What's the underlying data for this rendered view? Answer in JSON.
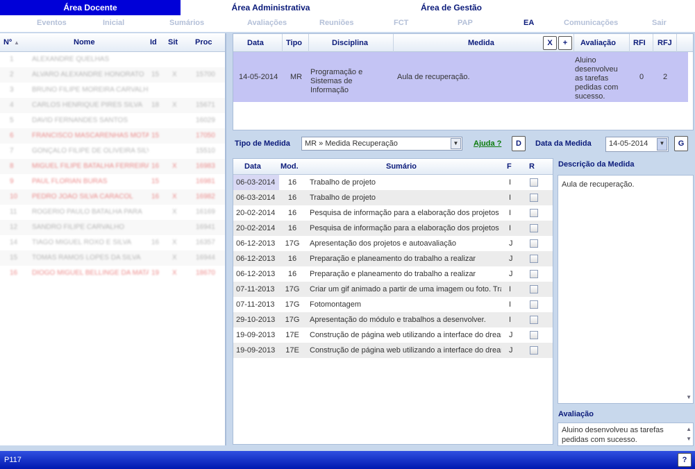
{
  "areas": [
    {
      "label": "Área Docente",
      "active": true
    },
    {
      "label": "Área Administrativa",
      "active": false
    },
    {
      "label": "Área de Gestão",
      "active": false
    }
  ],
  "nav": {
    "eventos": "Eventos",
    "inicial": "Inicial",
    "sumarios": "Sumários",
    "avaliacoes": "Avaliações",
    "reunioes": "Reuniões",
    "fct": "FCT",
    "pap": "PAP",
    "ea": "EA",
    "comunicacoes": "Comunicações",
    "sair": "Sair"
  },
  "students_table": {
    "headers": {
      "num": "Nº",
      "name": "Nome",
      "id": "Id",
      "sit": "Sit",
      "proc": "Proc"
    },
    "rows": [
      {
        "num": "1",
        "name": "ALEXANDRE QUELHAS",
        "id": "",
        "sit": "",
        "proc": "",
        "color": "#888888"
      },
      {
        "num": "2",
        "name": "ÁLVARO ALEXANDRE HONORATO",
        "id": "15",
        "sit": "X",
        "proc": "15700",
        "color": "#888888"
      },
      {
        "num": "3",
        "name": "BRUNO FILIPE MOREIRA CARVALHO",
        "id": "",
        "sit": "",
        "proc": "",
        "color": "#888888"
      },
      {
        "num": "4",
        "name": "CARLOS HENRIQUE PIRES SILVA",
        "id": "18",
        "sit": "X",
        "proc": "15671",
        "color": "#888888"
      },
      {
        "num": "5",
        "name": "DAVID FERNANDES SANTOS",
        "id": "",
        "sit": "",
        "proc": "16029",
        "color": "#888888"
      },
      {
        "num": "6",
        "name": "FRANCISCO MASCARENHAS MOTA",
        "id": "15",
        "sit": "",
        "proc": "17050",
        "color": "#e04040"
      },
      {
        "num": "7",
        "name": "GONÇALO FILIPE DE OLIVEIRA SILVA",
        "id": "",
        "sit": "",
        "proc": "15510",
        "color": "#888888"
      },
      {
        "num": "8",
        "name": "MIGUEL FILIPE BATALHA FERREIRA",
        "id": "16",
        "sit": "X",
        "proc": "16983",
        "color": "#e04040"
      },
      {
        "num": "9",
        "name": "PAUL FLORIAN BURAS",
        "id": "15",
        "sit": "",
        "proc": "16981",
        "color": "#e04040"
      },
      {
        "num": "10",
        "name": "PEDRO JOÃO SILVA CARACOL",
        "id": "16",
        "sit": "X",
        "proc": "16982",
        "color": "#e04040"
      },
      {
        "num": "11",
        "name": "ROGÉRIO PAULO BATALHA PARA",
        "id": "",
        "sit": "X",
        "proc": "16169",
        "color": "#888888"
      },
      {
        "num": "12",
        "name": "SANDRO FILIPE CARVALHO",
        "id": "",
        "sit": "",
        "proc": "16941",
        "color": "#888888"
      },
      {
        "num": "14",
        "name": "TIAGO MIGUEL ROXO E SILVA",
        "id": "16",
        "sit": "X",
        "proc": "16357",
        "color": "#888888"
      },
      {
        "num": "15",
        "name": "TOMÁS RAMOS LOPES DA SILVA",
        "id": "",
        "sit": "X",
        "proc": "16944",
        "color": "#888888"
      },
      {
        "num": "16",
        "name": "DIOGO MIGUEL BELLINGE DA MATA",
        "id": "19",
        "sit": "X",
        "proc": "18670",
        "color": "#e04040"
      }
    ]
  },
  "measures_table": {
    "headers": {
      "data": "Data",
      "tipo": "Tipo",
      "disciplina": "Disciplina",
      "medida": "Medida",
      "x_btn": "X",
      "plus_btn": "+",
      "avaliacao": "Avaliação",
      "rfi": "RFI",
      "rfj": "RFJ"
    },
    "row": {
      "data": "14-05-2014",
      "tipo": "MR",
      "disciplina": "Programação e Sistemas de Informação",
      "medida": "Aula de recuperação.",
      "avaliacao": "Aluino desenvolveu as tarefas pedidas com sucesso.",
      "rfi": "0",
      "rfj": "2"
    }
  },
  "toolbar": {
    "tipo_medida_label": "Tipo de Medida",
    "tipo_medida_value": "MR » Medida Recuperação",
    "ajuda_link": "Ajuda ?",
    "d_btn": "D",
    "data_medida_label": "Data da Medida",
    "data_medida_value": "14-05-2014",
    "g_btn": "G"
  },
  "summaries_table": {
    "headers": {
      "data": "Data",
      "mod": "Mod.",
      "sumario": "Sumário",
      "f": "F",
      "r": "R"
    },
    "rows": [
      {
        "data": "06-03-2014",
        "mod": "16",
        "sumario": "Trabalho de projeto",
        "f": "I",
        "r": false,
        "selected": true
      },
      {
        "data": "06-03-2014",
        "mod": "16",
        "sumario": "Trabalho de projeto",
        "f": "I",
        "r": false
      },
      {
        "data": "20-02-2014",
        "mod": "16",
        "sumario": "Pesquisa de informação para a elaboração dos projetos",
        "f": "I",
        "r": false
      },
      {
        "data": "20-02-2014",
        "mod": "16",
        "sumario": "Pesquisa de informação para a elaboração dos projetos",
        "f": "I",
        "r": false
      },
      {
        "data": "06-12-2013",
        "mod": "17G",
        "sumario": "Apresentação dos projetos e autoavaliação",
        "f": "J",
        "r": false
      },
      {
        "data": "06-12-2013",
        "mod": "16",
        "sumario": "Preparação e planeamento do trabalho a realizar",
        "f": "J",
        "r": false
      },
      {
        "data": "06-12-2013",
        "mod": "16",
        "sumario": "Preparação e planeamento do trabalho a realizar",
        "f": "J",
        "r": false
      },
      {
        "data": "07-11-2013",
        "mod": "17G",
        "sumario": "Criar um gif animado a partir de uma imagem ou foto. Tra",
        "f": "I",
        "r": false
      },
      {
        "data": "07-11-2013",
        "mod": "17G",
        "sumario": "Fotomontagem",
        "f": "I",
        "r": false
      },
      {
        "data": "29-10-2013",
        "mod": "17G",
        "sumario": "Apresentação do módulo e trabalhos a desenvolver.",
        "f": "I",
        "r": false
      },
      {
        "data": "19-09-2013",
        "mod": "17E",
        "sumario": "Construção de página web utilizando a interface do drear",
        "f": "J",
        "r": false
      },
      {
        "data": "19-09-2013",
        "mod": "17E",
        "sumario": "Construção de página web utilizando a interface do drear",
        "f": "J",
        "r": false
      }
    ]
  },
  "description": {
    "title": "Descrição da Medida",
    "text": "Aula de recuperação."
  },
  "evaluation": {
    "title": "Avaliação",
    "text": "Aluino desenvolveu as tarefas pedidas com sucesso."
  },
  "status": {
    "text": "P117",
    "help_btn": "?"
  },
  "colors": {
    "active_area": "#0000d8",
    "selected_row": "#c4c4f4",
    "header_text": "#0a1a7a",
    "status_bar": "#0018b0"
  }
}
